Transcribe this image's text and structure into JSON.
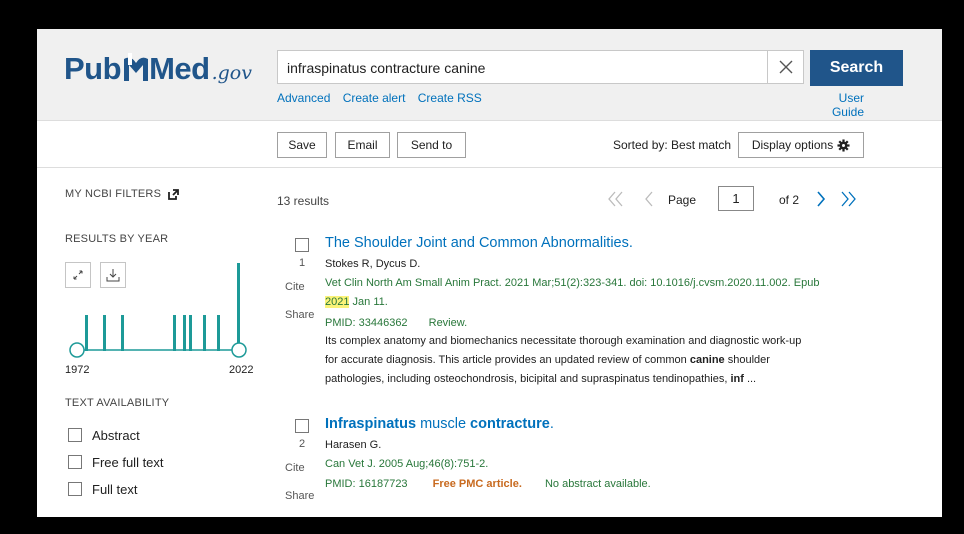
{
  "header": {
    "logo_pub": "Pub",
    "logo_med": "Med",
    "logo_gov": ".gov",
    "search_value": "infraspinatus contracture canine",
    "search_button": "Search",
    "links": [
      "Advanced",
      "Create alert",
      "Create RSS"
    ],
    "user_guide": "User Guide"
  },
  "toolbar": {
    "save": "Save",
    "email": "Email",
    "send_to": "Send to",
    "sorted_by": "Sorted by: Best match",
    "display_options": "Display options"
  },
  "sidebar": {
    "my_ncbi_filters": "MY NCBI FILTERS",
    "results_by_year": "RESULTS BY YEAR",
    "year_start": "1972",
    "year_end": "2022",
    "text_availability": "TEXT AVAILABILITY",
    "filters": [
      "Abstract",
      "Free full text",
      "Full text"
    ]
  },
  "results_header": {
    "count": "13 results",
    "page_label": "Page",
    "page_value": "1",
    "of_label": "of 2"
  },
  "results": [
    {
      "number": "1",
      "title": "The Shoulder Joint and Common Abnormalities.",
      "authors": "Stokes R, Dycus D.",
      "citation_line1": "Vet Clin North Am Small Anim Pract. 2021 Mar;51(2):323-341. doi: 10.1016/j.cvsm.2020.11.002. Epub",
      "citation_hl": "2021",
      "citation_line2": " Jan 11.",
      "pmid": "PMID: 33446362",
      "article_type": "Review.",
      "snippet_1": "Its complex anatomy and biomechanics necessitate thorough examination and diagnostic work-up",
      "snippet_2a": "for accurate diagnosis. This article provides an updated review of common ",
      "snippet_2b": "canine",
      "snippet_2c": " shoulder",
      "snippet_3a": "pathologies, including osteochondrosis, bicipital and supraspinatus tendinopathies, ",
      "snippet_3b": "inf",
      "snippet_3c": " ...",
      "cite": "Cite",
      "share": "Share"
    },
    {
      "number": "2",
      "title_b1": "Infraspinatus",
      "title_mid": " muscle ",
      "title_b2": "contracture",
      "title_end": ".",
      "authors": "Harasen G.",
      "citation": "Can Vet J. 2005 Aug;46(8):751-2.",
      "pmid": "PMID: 16187723",
      "free": "Free PMC article.",
      "no_abstract": "No abstract available.",
      "cite": "Cite",
      "share": "Share"
    }
  ],
  "colors": {
    "brand": "#20558a",
    "link": "#0071bc",
    "citation": "#28773a",
    "timeline": "#1d9a98",
    "highlight": "#fbf379"
  }
}
